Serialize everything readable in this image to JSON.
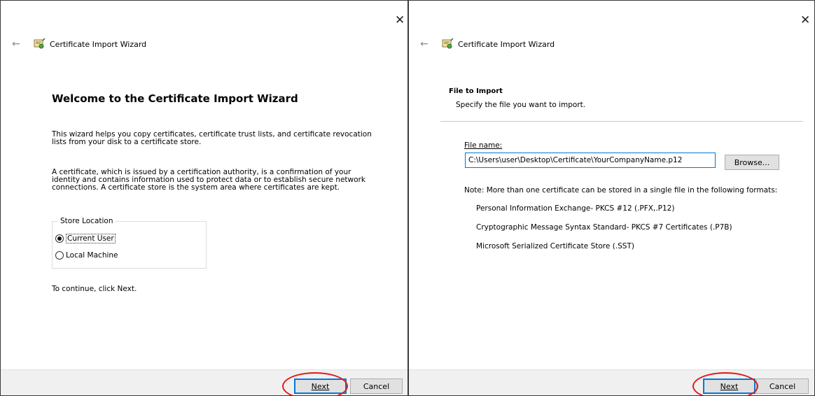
{
  "wizard_title": "Certificate Import Wizard",
  "close_glyph": "✕",
  "back_glyph": "←",
  "accent_color": "#0078d7",
  "annotation_color": "#e01818",
  "dialog1": {
    "welcome_title": "Welcome to the Certificate Import Wizard",
    "para1": "This wizard helps you copy certificates, certificate trust lists, and certificate revocation lists from your disk to a certificate store.",
    "para2": "A certificate, which is issued by a certification authority, is a confirmation of your identity and contains information used to protect data or to establish secure network connections. A certificate store is the system area where certificates are kept.",
    "store_location_label": "Store Location",
    "radio_current_user": "Current User",
    "radio_local_machine": "Local Machine",
    "selected_store": "Current User",
    "continue_text": "To continue, click Next.",
    "next_label": "Next",
    "cancel_label": "Cancel"
  },
  "dialog2": {
    "section_title": "File to Import",
    "section_subtitle": "Specify the file you want to import.",
    "file_name_label": "File name:",
    "file_name_value": "C:\\Users\\user\\Desktop\\Certificate\\YourCompanyName.p12",
    "browse_label": "Browse...",
    "note": "Note:  More than one certificate can be stored in a single file in the following formats:",
    "formats": [
      "Personal Information Exchange- PKCS #12 (.PFX,.P12)",
      "Cryptographic Message Syntax Standard- PKCS #7 Certificates (.P7B)",
      "Microsoft Serialized Certificate Store (.SST)"
    ],
    "next_label": "Next",
    "cancel_label": "Cancel"
  }
}
